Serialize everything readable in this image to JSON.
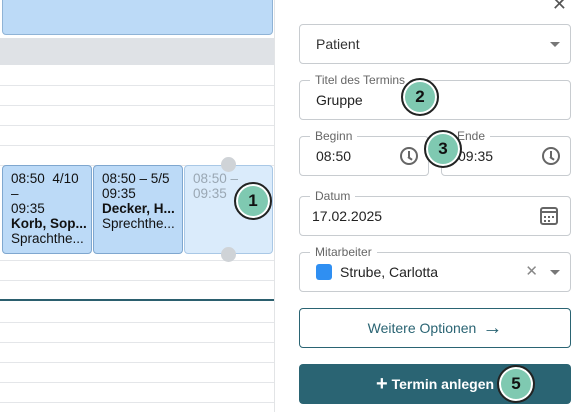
{
  "calendar": {
    "events": [
      {
        "time_start": "08:50",
        "sequence": "4/10",
        "dash": "–",
        "time_end": "09:35",
        "name": "Korb, Sop...",
        "type": "Sprachthe..."
      },
      {
        "time_range": "08:50 – 5/5",
        "time_end": "09:35",
        "name": "Decker, H...",
        "type": "Sprechthe..."
      }
    ],
    "ghost_event": {
      "time_range": "08:50 –",
      "time_end": "09:35"
    }
  },
  "form": {
    "close_icon": "✕",
    "patient_field": {
      "value": "Patient"
    },
    "title_field": {
      "label": "Titel des Termins",
      "value": "Gruppe"
    },
    "start_field": {
      "label": "Beginn",
      "value": "08:50"
    },
    "end_field": {
      "label": "Ende",
      "value": "09:35"
    },
    "date_field": {
      "label": "Datum",
      "value": "17.02.2025"
    },
    "staff_field": {
      "label": "Mitarbeiter",
      "value": "Strube, Carlotta",
      "color": "#2f8ff2",
      "clear_icon": "✕"
    },
    "more_options_button": {
      "label": "Weitere Optionen",
      "icon": "→"
    },
    "create_button": {
      "label": "Termin anlegen",
      "icon": "+"
    }
  },
  "markers": [
    "1",
    "2",
    "3",
    "5"
  ],
  "colors": {
    "accent": "#2a6473",
    "event_fill": "#bcdaf7",
    "marker_fill": "#7fc9b1"
  }
}
